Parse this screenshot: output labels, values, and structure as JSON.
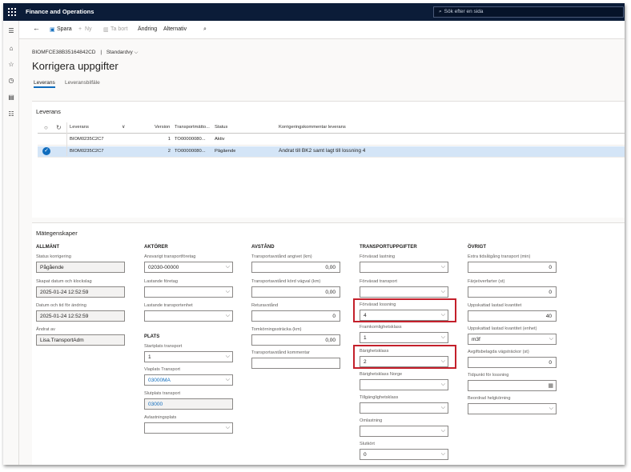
{
  "app": {
    "title": "Finance and Operations",
    "search_placeholder": "Sök efter en sida"
  },
  "colors": {
    "topbar": "#0b1c38",
    "accent": "#0f6cbd",
    "highlight": "#c4202b",
    "selected_row": "#d4e5f7"
  },
  "nav_icons": [
    "hamburger-icon",
    "home-icon",
    "star-icon",
    "clock-icon",
    "workspace-icon",
    "list-icon"
  ],
  "actionbar": {
    "save": "Spara",
    "new": "Ny",
    "delete": "Ta bort",
    "change": "Ändring",
    "options": "Alternativ"
  },
  "breadcrumb": {
    "record": "BIOMFCE38B35164842CD",
    "view": "Standardvy"
  },
  "page": {
    "title": "Korrigera uppgifter",
    "tabs": [
      "Leverans",
      "Leveransbilfäle"
    ]
  },
  "shipment_grid": {
    "section": "Leverans",
    "headers": {
      "shipment": "Leverans",
      "version": "Version",
      "transport": "Transportmätto...",
      "status": "Status",
      "comment": "Korrigeringskommentar leverans"
    },
    "rows": [
      {
        "shipment": "BIOM0235C2C7",
        "version": "1",
        "transport": "TO00000080...",
        "status": "Aktiv",
        "comment": ""
      },
      {
        "shipment": "BIOM0235C2C7",
        "version": "2",
        "transport": "TO00000080...",
        "status": "Pågående",
        "comment": "Ändrat till BK2 samt lagt till lossning 4"
      }
    ]
  },
  "props": {
    "section": "Mätegenskaper",
    "general": {
      "header": "ALLMÄNT",
      "status_label": "Status korrigering",
      "status": "Pågående",
      "created_label": "Skapat datum och klockslag",
      "created": "2025-01-24 12:52:59",
      "modified_label": "Datum och tid för ändring",
      "modified": "2025-01-24 12:52:59",
      "modified_by_label": "Ändrat av",
      "modified_by": "Lisa.TransportAdm"
    },
    "actors": {
      "header": "AKTÖRER",
      "carrier_label": "Ansvarigt transportföretag",
      "carrier": "02030-00000",
      "loading_company_label": "Lastande företag",
      "loading_company": "",
      "loading_unit_label": "Lastande transportenhet",
      "loading_unit": ""
    },
    "place": {
      "header": "PLATS",
      "start_label": "Startplats transport",
      "start": "1",
      "via_label": "Viaplats Transport",
      "via": "03000MA",
      "end_label": "Slutplats transport",
      "end": "03000",
      "unload_label": "Avlastningsplats",
      "unload": ""
    },
    "distance": {
      "header": "AVSTÅND",
      "stated_label": "Transportavstånd angivet (km)",
      "stated": "0,00",
      "road_label": "Transportavstånd körd vägval (km)",
      "road": "0,00",
      "return_label": "Returavstånd",
      "return": "0",
      "detour_label": "Tomkörningssträcka (km)",
      "detour": "0,00",
      "comment_label": "Transportavstånd kommentar",
      "comment": ""
    },
    "transport": {
      "header": "TRANSPORTUPPGIFTER",
      "forward_label": "Förväxad lastning",
      "forward": "",
      "forward_transport_label": "Förväxad transport",
      "forward_transport": "",
      "forward_unload_label": "Förväxad lossning",
      "forward_unload": "4",
      "transportability_label": "Framkomlighetsklass",
      "transportability": "1",
      "bearing_label": "Bärighetsklass",
      "bearing": "2",
      "bearing_norway_label": "Bärighetsklass Norge",
      "bearing_norway": "",
      "access_label": "Tillgänglighetsklass",
      "access": "",
      "reloading_label": "Omlastning",
      "reloading": "",
      "final_label": "Slutkört",
      "final": "0"
    },
    "other": {
      "header": "ÖVRIGT",
      "extra_time_label": "Extra tidsåtgång transport (min)",
      "extra_time": "0",
      "ferry_label": "Färjeöverfarter (st)",
      "ferry": "0",
      "est_loaded_label": "Uppskattad lastad kvantitet",
      "est_loaded": "40",
      "est_unit_label": "Uppskattad lastad kvantitet (enhet)",
      "est_unit": "m3f",
      "toll_label": "Avgiftsbelagda vägsträckor (st)",
      "toll": "0",
      "unload_time_label": "Tidpunkt för lossning",
      "unload_time": "",
      "holiday_label": "Beordrad helgkörning",
      "holiday": ""
    }
  }
}
